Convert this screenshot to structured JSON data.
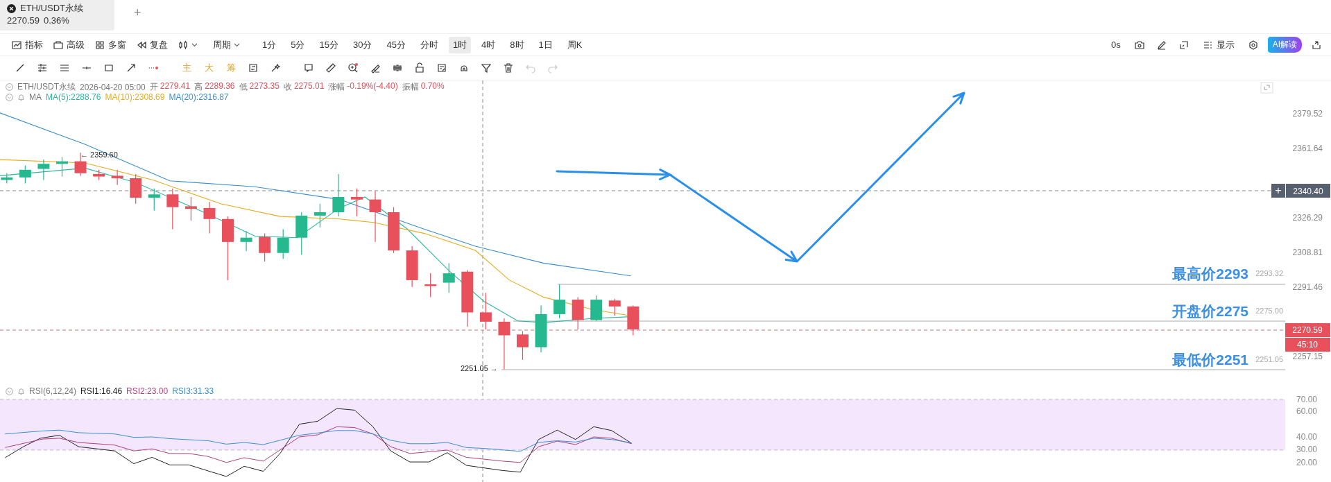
{
  "tab": {
    "title": "ETH/USDT永续",
    "price": "2270.59",
    "change": "0.36%",
    "add": "+"
  },
  "toolbar": {
    "left": [
      {
        "kind": "indicator",
        "label": "指标"
      },
      {
        "kind": "advanced",
        "label": "高级"
      },
      {
        "kind": "multi",
        "label": "多窗"
      },
      {
        "kind": "replay",
        "label": "复盘"
      },
      {
        "kind": "candles"
      }
    ],
    "period": "周期",
    "intervals": [
      {
        "label": "1分",
        "selected": false
      },
      {
        "label": "5分",
        "selected": false
      },
      {
        "label": "15分",
        "selected": false
      },
      {
        "label": "30分",
        "selected": false
      },
      {
        "label": "45分",
        "selected": false
      },
      {
        "label": "分时",
        "selected": false
      },
      {
        "label": "1时",
        "selected": true
      },
      {
        "label": "4时",
        "selected": false
      },
      {
        "label": "8时",
        "selected": false
      },
      {
        "label": "1日",
        "selected": false
      },
      {
        "label": "周K",
        "selected": false
      }
    ],
    "right": [
      {
        "kind": "text",
        "label": "0s"
      },
      {
        "kind": "camera"
      },
      {
        "kind": "pen"
      },
      {
        "kind": "frame"
      },
      {
        "kind": "display",
        "label": "显示"
      },
      {
        "kind": "settings"
      },
      {
        "kind": "ai",
        "label": "AI解读"
      },
      {
        "kind": "share"
      }
    ]
  },
  "drawing_tools": [
    {
      "items": [
        {
          "kind": "trend-line",
          "disabled": false
        },
        {
          "kind": "sliders",
          "disabled": false
        },
        {
          "kind": "lines",
          "disabled": false
        },
        {
          "kind": "h-line",
          "disabled": false
        },
        {
          "kind": "rect",
          "disabled": false
        },
        {
          "kind": "arrow",
          "disabled": false
        },
        {
          "kind": "more",
          "disabled": false
        }
      ]
    },
    {
      "items": [
        {
          "kind": "text",
          "label": "主",
          "disabled": false
        },
        {
          "kind": "text",
          "label": "大",
          "disabled": false
        },
        {
          "kind": "text",
          "label": "筹",
          "disabled": false
        },
        {
          "kind": "swap",
          "disabled": false
        },
        {
          "kind": "magic",
          "disabled": false
        }
      ]
    },
    {
      "items": [
        {
          "kind": "note",
          "disabled": false
        },
        {
          "kind": "ruler",
          "disabled": false
        },
        {
          "kind": "zoom",
          "disabled": false
        },
        {
          "kind": "eraser",
          "disabled": false
        },
        {
          "kind": "bars",
          "disabled": false
        },
        {
          "kind": "lock",
          "disabled": false
        },
        {
          "kind": "edit",
          "disabled": false
        },
        {
          "kind": "magnet",
          "disabled": false
        },
        {
          "kind": "filter",
          "disabled": false
        },
        {
          "kind": "trash",
          "disabled": false
        },
        {
          "kind": "undo",
          "disabled": true
        },
        {
          "kind": "redo",
          "disabled": true
        }
      ]
    }
  ],
  "legend": {
    "symbol": "ETH/USDT永续",
    "time": "2026-04-20 05:00",
    "fields": [
      {
        "label": "开",
        "value": "2279.41"
      },
      {
        "label": "高",
        "value": "2289.36"
      },
      {
        "label": "低",
        "value": "2273.35"
      },
      {
        "label": "收",
        "value": "2275.01"
      },
      {
        "label": "涨幅",
        "value": "-0.19%(-4.40)"
      },
      {
        "label": "振幅",
        "value": "0.70%"
      }
    ],
    "ma_name": "MA",
    "ma": [
      {
        "label": "MA(5):2288.76",
        "color": "#2bb8a0"
      },
      {
        "label": "MA(10):2308.69",
        "color": "#e8ac1c"
      },
      {
        "label": "MA(20):2316.87",
        "color": "#3a8fd0"
      }
    ]
  },
  "price_axis": {
    "ticks": [
      "2379.52",
      "2361.64",
      "2326.29",
      "2308.81",
      "2291.46",
      "2257.15"
    ],
    "crosshair_price": "2340.40",
    "crosshair_add": "+",
    "last_price": "2270.59",
    "countdown": "45:10"
  },
  "markers": {
    "high": "← 2359.60",
    "low": "2251.05 →"
  },
  "annotations": [
    {
      "label": "最高价2293",
      "price": "2293.32"
    },
    {
      "label": "开盘价2275",
      "price": "2275.00"
    },
    {
      "label": "最低价2251",
      "price": "2251.05"
    }
  ],
  "rsi": {
    "name": "RSI(6,12,24)",
    "lines": [
      {
        "label": "RSI1:16.46",
        "color": "#222222"
      },
      {
        "label": "RSI2:23.00",
        "color": "#b0407a"
      },
      {
        "label": "RSI3:31.33",
        "color": "#3a90d0"
      }
    ],
    "ticks": [
      "70.00",
      "60.00",
      "40.00",
      "30.00",
      "20.00"
    ]
  }
}
